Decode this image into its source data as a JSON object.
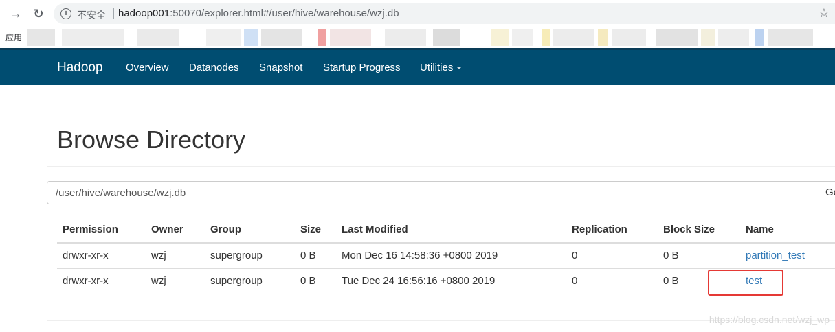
{
  "browser": {
    "security_label": "不安全",
    "url_host": "hadoop001",
    "url_rest": ":50070/explorer.html#/user/hive/warehouse/wzj.db",
    "bookmarks_apps_label": "应用"
  },
  "navbar": {
    "brand": "Hadoop",
    "links": [
      "Overview",
      "Datanodes",
      "Snapshot",
      "Startup Progress",
      "Utilities"
    ]
  },
  "page": {
    "title": "Browse Directory",
    "path_value": "/user/hive/warehouse/wzj.db",
    "go_label": "Go"
  },
  "table": {
    "headers": [
      "Permission",
      "Owner",
      "Group",
      "Size",
      "Last Modified",
      "Replication",
      "Block Size",
      "Name"
    ],
    "rows": [
      [
        "drwxr-xr-x",
        "wzj",
        "supergroup",
        "0 B",
        "Mon Dec 16 14:58:36 +0800 2019",
        "0",
        "0 B",
        "partition_test"
      ],
      [
        "drwxr-xr-x",
        "wzj",
        "supergroup",
        "0 B",
        "Tue Dec 24 16:56:16 +0800 2019",
        "0",
        "0 B",
        "test"
      ]
    ]
  },
  "watermark": "https://blog.csdn.net/wzj_wp",
  "colors": {
    "navbar": "#004d71",
    "link": "#337ab7",
    "highlight": "#e53935"
  }
}
